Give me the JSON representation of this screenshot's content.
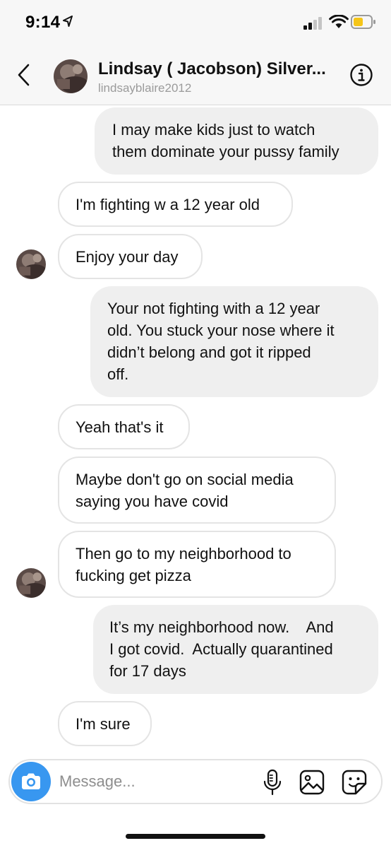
{
  "status_bar": {
    "time": "9:14"
  },
  "header": {
    "name": "Lindsay ( Jacobson) Silver...",
    "username": "lindsayblaire2012",
    "back_icon": "chevron-left-icon",
    "info_icon": "info-icon"
  },
  "messages": [
    {
      "direction": "outgoing",
      "text": "I may make kids just to watch\nthem dominate your pussy family"
    },
    {
      "direction": "incoming",
      "text": "I'm fighting w a 12 year old"
    },
    {
      "direction": "incoming",
      "text": "Enjoy your day"
    },
    {
      "direction": "outgoing",
      "text": "Your not fighting with a 12 year\nold. You stuck your nose where it\ndidn’t belong and got it ripped\noff."
    },
    {
      "direction": "incoming",
      "text": "Yeah that's it"
    },
    {
      "direction": "incoming",
      "text": "Maybe don't go on social media\nsaying you have covid"
    },
    {
      "direction": "incoming",
      "text": "Then go to my neighborhood to\nfucking get pizza"
    },
    {
      "direction": "outgoing",
      "text": "It’s my neighborhood now.    And\nI got covid.  Actually quarantined\nfor 17 days"
    },
    {
      "direction": "incoming",
      "text": "I'm sure"
    }
  ],
  "composer": {
    "placeholder": "Message...",
    "value": "",
    "icons": [
      "camera-icon",
      "microphone-icon",
      "gallery-icon",
      "sticker-icon"
    ]
  },
  "colors": {
    "accent": "#3897f0",
    "outgoing_bubble": "#efefef",
    "incoming_border": "#e4e4e4",
    "header_bg": "#f7f7f7",
    "muted_text": "#9b9b9b"
  }
}
